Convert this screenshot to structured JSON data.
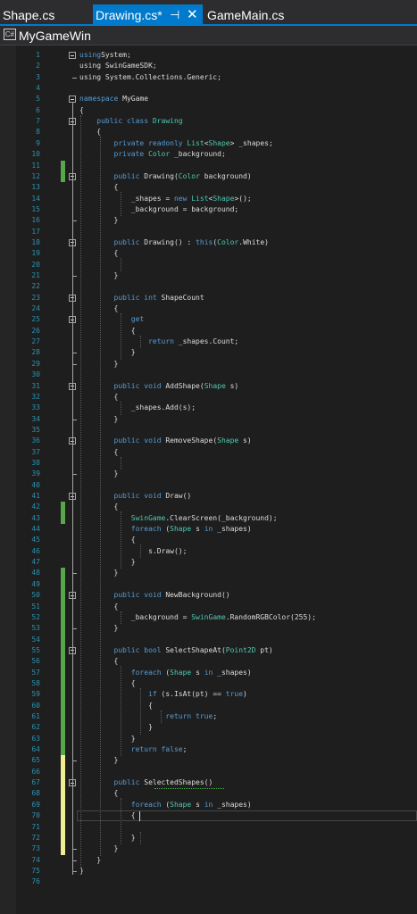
{
  "tabs": [
    {
      "label": "Shape.cs",
      "active": false
    },
    {
      "label": "Drawing.cs*",
      "active": true,
      "pin_icon": "pin-icon",
      "close_icon": "close-icon"
    },
    {
      "label": "GameMain.cs",
      "active": false
    }
  ],
  "project": {
    "icon": "csharp-project-icon",
    "icon_text": "C#",
    "name": "MyGameWin"
  },
  "colors": {
    "keyword": "#569cd6",
    "type": "#4ec9b0",
    "text": "#dcdcdc",
    "line_number": "#2b91af",
    "saved_change": "#57a64a",
    "unsaved_change": "#efef91",
    "accent": "#007acc"
  },
  "code": [
    [
      [
        "k",
        "using"
      ],
      [
        "",
        "System;"
      ]
    ],
    [
      [
        "",
        "using SwinGameSDK;"
      ]
    ],
    [
      [
        "",
        "using System.Collections.Generic;"
      ]
    ],
    [],
    [
      [
        "k",
        "namespace"
      ],
      [
        "",
        " MyGame"
      ]
    ],
    [
      [
        "",
        "{"
      ]
    ],
    [
      [
        "",
        "    "
      ],
      [
        "k",
        "public class"
      ],
      [
        "",
        ""
      ],
      [
        "t",
        " Drawing"
      ]
    ],
    [
      [
        "",
        "    {"
      ]
    ],
    [
      [
        "",
        "        "
      ],
      [
        "k",
        "private readonly"
      ],
      [
        "",
        ""
      ],
      [
        "t",
        " List"
      ],
      [
        "",
        "<"
      ],
      [
        "t",
        "Shape"
      ],
      [
        "",
        "> _shapes;"
      ]
    ],
    [
      [
        "",
        "        "
      ],
      [
        "k",
        "private"
      ],
      [
        "t",
        " Color"
      ],
      [
        "",
        " _background;"
      ]
    ],
    [],
    [
      [
        "",
        "        "
      ],
      [
        "k",
        "public"
      ],
      [
        "",
        " Drawing("
      ],
      [
        "t",
        "Color"
      ],
      [
        "",
        " background)"
      ]
    ],
    [
      [
        "",
        "        {"
      ]
    ],
    [
      [
        "",
        "            _shapes = "
      ],
      [
        "k",
        "new"
      ],
      [
        "t",
        " List"
      ],
      [
        "",
        "<"
      ],
      [
        "t",
        "Shape"
      ],
      [
        "",
        ">();"
      ]
    ],
    [
      [
        "",
        "            _background = background;"
      ]
    ],
    [
      [
        "",
        "        }"
      ]
    ],
    [],
    [
      [
        "",
        "        "
      ],
      [
        "k",
        "public"
      ],
      [
        "",
        " Drawing() : "
      ],
      [
        "k",
        "this"
      ],
      [
        "",
        "("
      ],
      [
        "t",
        "Color"
      ],
      [
        "",
        ".White)"
      ]
    ],
    [
      [
        "",
        "        {"
      ]
    ],
    [],
    [
      [
        "",
        "        }"
      ]
    ],
    [],
    [
      [
        "",
        "        "
      ],
      [
        "k",
        "public int"
      ],
      [
        "",
        " ShapeCount"
      ]
    ],
    [
      [
        "",
        "        {"
      ]
    ],
    [
      [
        "",
        "            "
      ],
      [
        "k",
        "get"
      ]
    ],
    [
      [
        "",
        "            {"
      ]
    ],
    [
      [
        "",
        "                "
      ],
      [
        "k",
        "return"
      ],
      [
        "",
        " _shapes.Count;"
      ]
    ],
    [
      [
        "",
        "            }"
      ]
    ],
    [
      [
        "",
        "        }"
      ]
    ],
    [],
    [
      [
        "",
        "        "
      ],
      [
        "k",
        "public void"
      ],
      [
        "",
        " AddShape("
      ],
      [
        "t",
        "Shape"
      ],
      [
        "",
        " s)"
      ]
    ],
    [
      [
        "",
        "        {"
      ]
    ],
    [
      [
        "",
        "            _shapes.Add(s);"
      ]
    ],
    [
      [
        "",
        "        }"
      ]
    ],
    [],
    [
      [
        "",
        "        "
      ],
      [
        "k",
        "public void"
      ],
      [
        "",
        " RemoveShape("
      ],
      [
        "t",
        "Shape"
      ],
      [
        "",
        " s)"
      ]
    ],
    [
      [
        "",
        "        {"
      ]
    ],
    [],
    [
      [
        "",
        "        }"
      ]
    ],
    [],
    [
      [
        "",
        "        "
      ],
      [
        "k",
        "public void"
      ],
      [
        "",
        " Draw()"
      ]
    ],
    [
      [
        "",
        "        {"
      ]
    ],
    [
      [
        "",
        "            "
      ],
      [
        "t",
        "SwinGame"
      ],
      [
        "",
        ".ClearScreen(_background);"
      ]
    ],
    [
      [
        "",
        "            "
      ],
      [
        "k",
        "foreach"
      ],
      [
        "",
        " ("
      ],
      [
        "t",
        "Shape"
      ],
      [
        "",
        " s "
      ],
      [
        "k",
        "in"
      ],
      [
        "",
        " _shapes)"
      ]
    ],
    [
      [
        "",
        "            {"
      ]
    ],
    [
      [
        "",
        "                s.Draw();"
      ]
    ],
    [
      [
        "",
        "            }"
      ]
    ],
    [
      [
        "",
        "        }"
      ]
    ],
    [],
    [
      [
        "",
        "        "
      ],
      [
        "k",
        "public void"
      ],
      [
        "",
        " NewBackground()"
      ]
    ],
    [
      [
        "",
        "        {"
      ]
    ],
    [
      [
        "",
        "            _background = "
      ],
      [
        "t",
        "SwinGame"
      ],
      [
        "",
        ".RandomRGBColor(255);"
      ]
    ],
    [
      [
        "",
        "        }"
      ]
    ],
    [],
    [
      [
        "",
        "        "
      ],
      [
        "k",
        "public bool"
      ],
      [
        "",
        " SelectShapeAt("
      ],
      [
        "t",
        "Point2D"
      ],
      [
        "",
        " pt)"
      ]
    ],
    [
      [
        "",
        "        {"
      ]
    ],
    [
      [
        "",
        "            "
      ],
      [
        "k",
        "foreach"
      ],
      [
        "",
        " ("
      ],
      [
        "t",
        "Shape"
      ],
      [
        "",
        " s "
      ],
      [
        "k",
        "in"
      ],
      [
        "",
        " _shapes)"
      ]
    ],
    [
      [
        "",
        "            {"
      ]
    ],
    [
      [
        "",
        "                "
      ],
      [
        "k",
        "if"
      ],
      [
        "",
        " (s.IsAt(pt) == "
      ],
      [
        "k",
        "true"
      ],
      [
        "",
        ")"
      ]
    ],
    [
      [
        "",
        "                {"
      ]
    ],
    [
      [
        "",
        "                    "
      ],
      [
        "k",
        "return true"
      ],
      [
        "",
        ";"
      ]
    ],
    [
      [
        "",
        "                }"
      ]
    ],
    [
      [
        "",
        "            }"
      ]
    ],
    [
      [
        "",
        "            "
      ],
      [
        "k",
        "return false"
      ],
      [
        "",
        ";"
      ]
    ],
    [
      [
        "",
        "        }"
      ]
    ],
    [],
    [
      [
        "",
        "        "
      ],
      [
        "k",
        "public"
      ],
      [
        "",
        " SelectedShapes()"
      ]
    ],
    [
      [
        "",
        "        {"
      ]
    ],
    [
      [
        "",
        "            "
      ],
      [
        "k",
        "foreach"
      ],
      [
        "",
        " ("
      ],
      [
        "t",
        "Shape"
      ],
      [
        "",
        " s "
      ],
      [
        "k",
        "in"
      ],
      [
        "",
        " _shapes)"
      ]
    ],
    [
      [
        "",
        "            {"
      ]
    ],
    [],
    [
      [
        "",
        "            }"
      ]
    ],
    [
      [
        "",
        "        }"
      ]
    ],
    [
      [
        "",
        "    }"
      ]
    ],
    [
      [
        "",
        "}"
      ]
    ],
    []
  ]
}
